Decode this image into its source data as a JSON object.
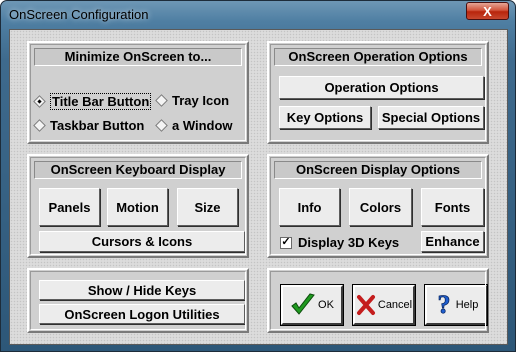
{
  "window": {
    "title": "OnScreen Configuration",
    "close_glyph": "X"
  },
  "minimize": {
    "header": "Minimize OnScreen to...",
    "options": [
      {
        "label": "Title Bar Button",
        "selected": true
      },
      {
        "label": "Tray Icon",
        "selected": false
      },
      {
        "label": "Taskbar Button",
        "selected": false
      },
      {
        "label": "a Window",
        "selected": false
      }
    ]
  },
  "operation": {
    "header": "OnScreen Operation Options",
    "operation_options": "Operation Options",
    "key_options": "Key Options",
    "special_options": "Special Options"
  },
  "keyboard": {
    "header": "OnScreen Keyboard Display",
    "panels": "Panels",
    "motion": "Motion",
    "size": "Size",
    "cursors_icons": "Cursors & Icons"
  },
  "display": {
    "header": "OnScreen Display Options",
    "info": "Info",
    "colors": "Colors",
    "fonts": "Fonts",
    "display_3d_label": "Display 3D Keys",
    "display_3d_checked": true,
    "enhance": "Enhance"
  },
  "utilities": {
    "show_hide_keys": "Show / Hide Keys",
    "logon_utilities": "OnScreen Logon Utilities"
  },
  "dialog": {
    "ok": "OK",
    "cancel": "Cancel",
    "help": "Help"
  },
  "icons": {
    "ok": "checkmark-icon",
    "cancel": "cross-icon",
    "help": "question-icon"
  },
  "colors": {
    "ok_green": "#1f9a1f",
    "cancel_red": "#c41d1d",
    "help_blue": "#1f5fd1"
  }
}
